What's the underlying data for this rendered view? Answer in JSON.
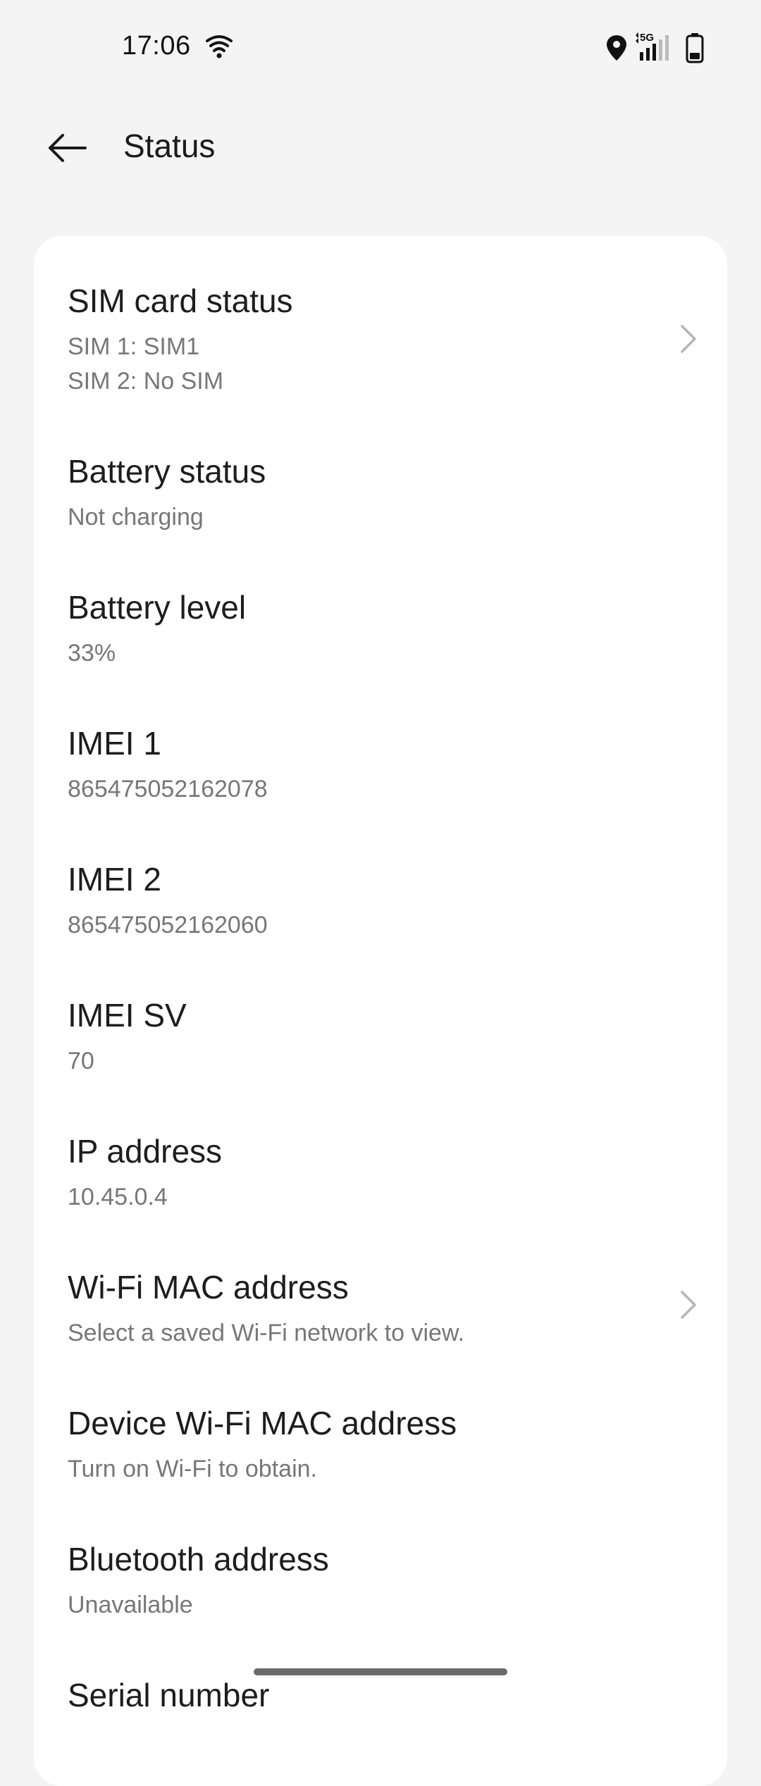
{
  "status_bar": {
    "time": "17:06",
    "network_label": "5G",
    "icons": [
      "wifi-icon",
      "location-icon",
      "signal-5g-icon",
      "battery-icon"
    ]
  },
  "app_bar": {
    "title": "Status",
    "back_icon": "arrow-left-icon"
  },
  "items": [
    {
      "title": "SIM card status",
      "subtitle_lines": [
        "SIM 1: SIM1",
        "SIM 2: No SIM"
      ],
      "has_chevron": true
    },
    {
      "title": "Battery status",
      "subtitle": "Not charging",
      "has_chevron": false
    },
    {
      "title": "Battery level",
      "subtitle": "33%",
      "has_chevron": false
    },
    {
      "title": "IMEI 1",
      "subtitle": "865475052162078",
      "has_chevron": false
    },
    {
      "title": "IMEI 2",
      "subtitle": "865475052162060",
      "has_chevron": false
    },
    {
      "title": "IMEI SV",
      "subtitle": "70",
      "has_chevron": false
    },
    {
      "title": "IP address",
      "subtitle": "10.45.0.4",
      "has_chevron": false
    },
    {
      "title": "Wi-Fi MAC address",
      "subtitle": "Select a saved Wi-Fi network to view.",
      "has_chevron": true
    },
    {
      "title": "Device Wi-Fi MAC address",
      "subtitle": "Turn on Wi-Fi to obtain.",
      "has_chevron": false
    },
    {
      "title": "Bluetooth address",
      "subtitle": "Unavailable",
      "has_chevron": false
    },
    {
      "title": "Serial number",
      "has_chevron": false
    }
  ],
  "colors": {
    "background": "#f4f4f4",
    "card": "#ffffff",
    "title_text": "#1d1d1d",
    "subtitle_text": "#777777",
    "chevron": "#b5b5b5"
  }
}
